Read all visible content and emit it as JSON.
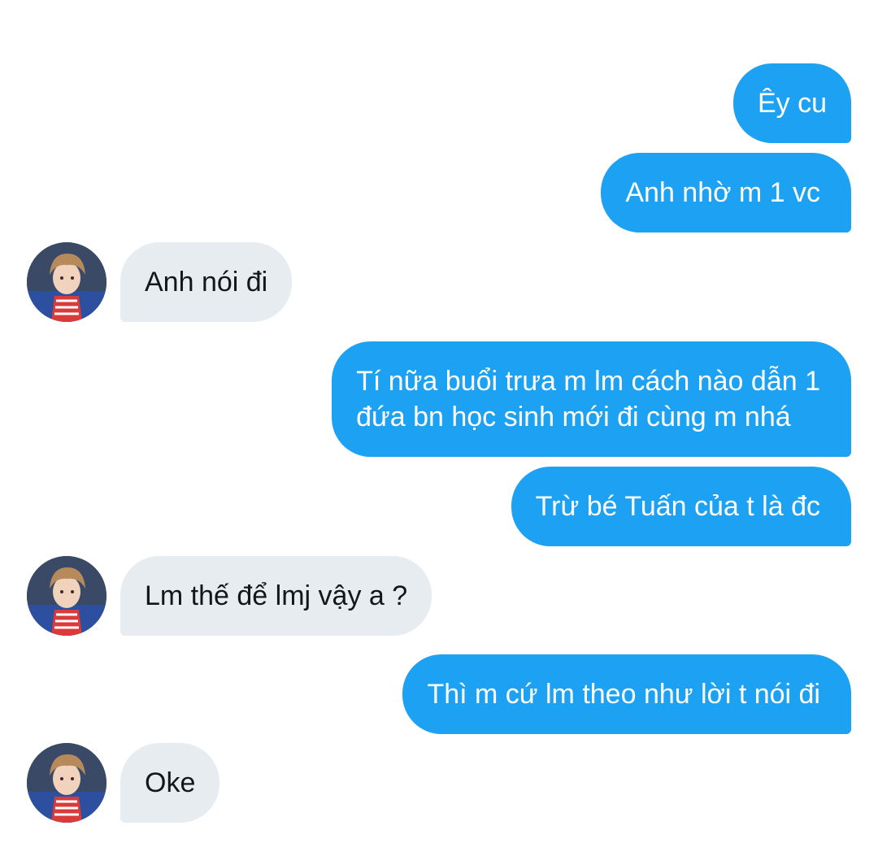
{
  "conversation": {
    "messages": [
      {
        "direction": "outgoing",
        "text": "Êy cu"
      },
      {
        "direction": "outgoing",
        "text": "Anh nhờ m 1 vc"
      },
      {
        "direction": "incoming",
        "text": "Anh nói đi"
      },
      {
        "direction": "outgoing",
        "text": "Tí nữa buổi trưa m lm cách nào dẫn 1 đứa bn học sinh mới đi cùng m nhá",
        "lines": [
          "Tí nữa buổi trưa m lm cách nào dẫn 1",
          "đứa bn học sinh mới đi cùng m nhá"
        ]
      },
      {
        "direction": "outgoing",
        "text": "Trừ bé Tuấn của t là đc"
      },
      {
        "direction": "incoming",
        "text": "Lm thế để lmj vậy a ?"
      },
      {
        "direction": "outgoing",
        "text": "Thì m cứ lm theo như lời t nói đi"
      },
      {
        "direction": "incoming",
        "text": "Oke"
      }
    ]
  },
  "colors": {
    "outgoing_bubble": "#1da1f2",
    "incoming_bubble": "#e6ecf0",
    "outgoing_text": "#ffffff",
    "incoming_text": "#14171a",
    "background": "#ffffff"
  },
  "icons": {
    "avatar": "contact-avatar-photo"
  }
}
